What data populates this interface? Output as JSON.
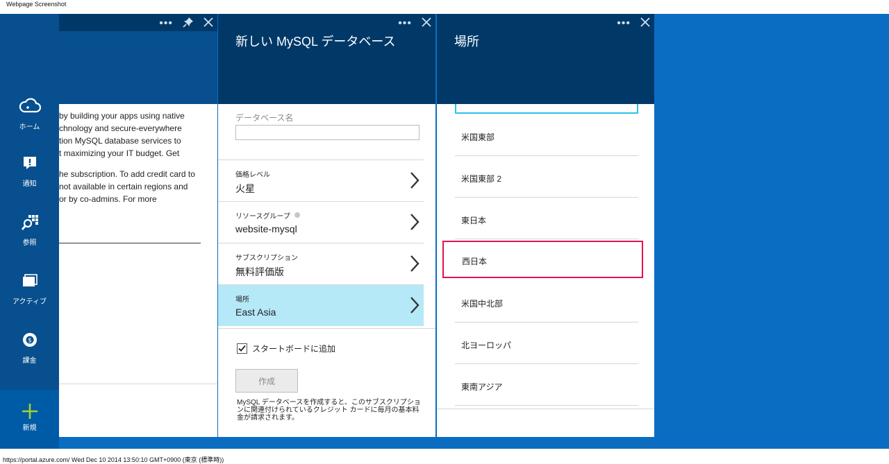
{
  "window": {
    "title": "Webpage Screenshot",
    "status": "https://portal.azure.com/ Wed Dec 10 2014 13:50:10 GMT+0900 (東京 (標準時))"
  },
  "nav": {
    "items": [
      {
        "label": "ホーム",
        "icon": "cloud-icon"
      },
      {
        "label": "通知",
        "icon": "notification-icon"
      },
      {
        "label": "参照",
        "icon": "browse-icon"
      },
      {
        "label": "アクティブ",
        "icon": "active-windows-icon"
      },
      {
        "label": "課金",
        "icon": "billing-icon"
      }
    ],
    "new_label": "新規"
  },
  "blade1": {
    "paragraph1": [
      " by building your apps using native",
      "chnology and secure-everywhere",
      "tion MySQL database services to",
      "t maximizing your IT budget. Get"
    ],
    "paragraph2": [
      "he subscription. To add credit card to",
      "not available in certain regions and",
      " or by co-admins. For more"
    ]
  },
  "blade2": {
    "title": "新しい MySQL データベース",
    "db_name_label": "データベース名",
    "db_name_value": "",
    "rows": [
      {
        "label": "価格レベル",
        "value": "火星"
      },
      {
        "label": "リソースグループ",
        "value": "website-mysql"
      },
      {
        "label": "サブスクリプション",
        "value": "無料評価版"
      },
      {
        "label": "場所",
        "value": "East Asia"
      }
    ],
    "pin_label": "スタートボードに追加",
    "pin_checked": true,
    "create_label": "作成",
    "note": "MySQL データベースを作成すると、このサブスクリプションに関連付けられているクレジット カードに毎月の基本料金が請求されます。"
  },
  "blade3": {
    "title": "場所",
    "locations": [
      "米国東部",
      "米国東部 2",
      "東日本",
      "西日本",
      "米国中北部",
      "北ヨーロッパ",
      "東南アジア"
    ],
    "highlighted": "西日本"
  },
  "colors": {
    "portal_bg": "#0a6dc2",
    "nav_bg": "#074f8e",
    "header_bg": "#003968",
    "selected_row": "#b5e9f8",
    "highlight_border": "#e0124f",
    "search_border": "#2cc1e6",
    "new_plus": "#a5d234"
  }
}
